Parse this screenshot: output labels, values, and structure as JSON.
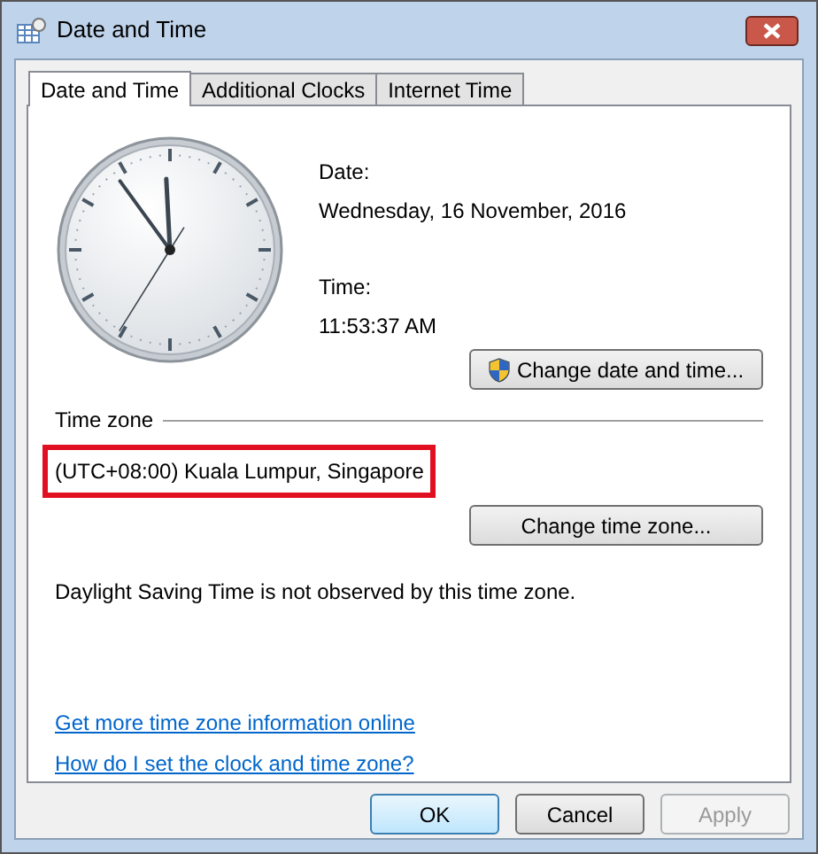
{
  "window": {
    "title": "Date and Time"
  },
  "tabs": [
    {
      "label": "Date and Time",
      "selected": true
    },
    {
      "label": "Additional Clocks",
      "selected": false
    },
    {
      "label": "Internet Time",
      "selected": false
    }
  ],
  "date": {
    "label": "Date:",
    "value": "Wednesday, 16 November, 2016"
  },
  "time": {
    "label": "Time:",
    "value": "11:53:37 AM"
  },
  "change_date_button": {
    "label": "Change date and time...",
    "shield": true
  },
  "time_zone": {
    "heading": "Time zone",
    "value": "(UTC+08:00) Kuala Lumpur, Singapore",
    "highlighted": true
  },
  "change_zone_button": {
    "label": "Change time zone..."
  },
  "dst_note": "Daylight Saving Time is not observed by this time zone.",
  "links": [
    "Get more time zone information online",
    "How do I set the clock and time zone?"
  ],
  "buttons": [
    {
      "label": "OK",
      "default": true,
      "disabled": false
    },
    {
      "label": "Cancel",
      "default": false,
      "disabled": false
    },
    {
      "label": "Apply",
      "default": false,
      "disabled": true
    }
  ]
}
